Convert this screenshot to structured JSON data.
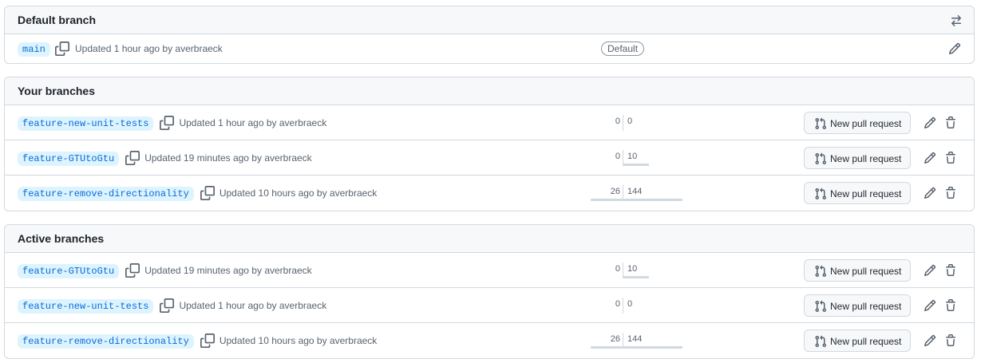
{
  "default_branch": {
    "title": "Default branch",
    "header_icon": "arrow-switch-icon",
    "branch": {
      "name": "main",
      "updated": "Updated 1 hour ago by averbraeck",
      "badge": "Default"
    }
  },
  "your_branches": {
    "title": "Your branches",
    "rows": [
      {
        "name": "feature-new-unit-tests",
        "updated": "Updated 1 hour ago by averbraeck",
        "behind": "0",
        "ahead": "0",
        "behind_value": 0,
        "ahead_value": 0,
        "pr_label": "New pull request"
      },
      {
        "name": "feature-GTUtoGtu",
        "updated": "Updated 19 minutes ago by averbraeck",
        "behind": "0",
        "ahead": "10",
        "behind_value": 0,
        "ahead_value": 10,
        "pr_label": "New pull request"
      },
      {
        "name": "feature-remove-directionality",
        "updated": "Updated 10 hours ago by averbraeck",
        "behind": "26",
        "ahead": "144",
        "behind_value": 26,
        "ahead_value": 144,
        "pr_label": "New pull request"
      }
    ]
  },
  "active_branches": {
    "title": "Active branches",
    "rows": [
      {
        "name": "feature-GTUtoGtu",
        "updated": "Updated 19 minutes ago by averbraeck",
        "behind": "0",
        "ahead": "10",
        "behind_value": 0,
        "ahead_value": 10,
        "pr_label": "New pull request"
      },
      {
        "name": "feature-new-unit-tests",
        "updated": "Updated 1 hour ago by averbraeck",
        "behind": "0",
        "ahead": "0",
        "behind_value": 0,
        "ahead_value": 0,
        "pr_label": "New pull request"
      },
      {
        "name": "feature-remove-directionality",
        "updated": "Updated 10 hours ago by averbraeck",
        "behind": "26",
        "ahead": "144",
        "behind_value": 26,
        "ahead_value": 144,
        "pr_label": "New pull request"
      }
    ]
  },
  "colors": {
    "branch_text": "#0969da",
    "branch_bg": "#ddf4ff",
    "border": "#d1d9e0",
    "muted_text": "#59636e"
  }
}
